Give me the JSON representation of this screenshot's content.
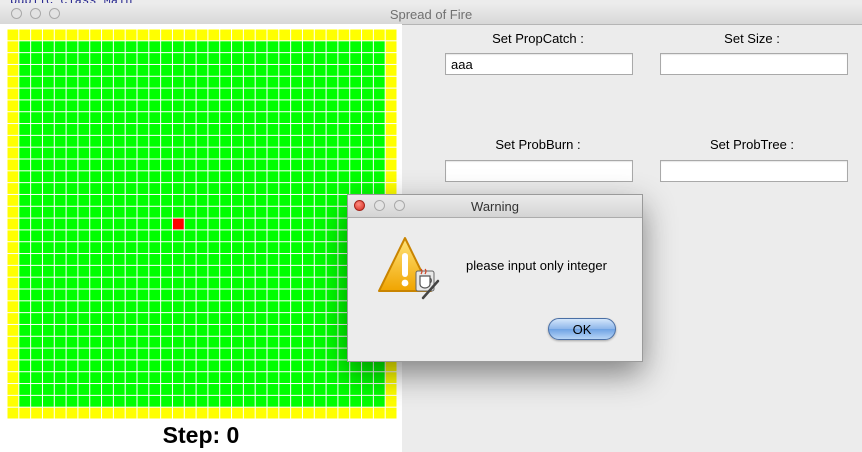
{
  "background_app": {
    "code_text": "public class Main"
  },
  "window": {
    "title": "Spread of Fire"
  },
  "simulation": {
    "grid_size": 33,
    "colors": {
      "border_cell": "#ffff00",
      "tree_cell": "#00ff00",
      "burning_cell": "#ff0000",
      "grid_line": "#ffffff"
    },
    "burning_cell": {
      "row": 16,
      "col": 14
    },
    "step_text": "Step: 0"
  },
  "form": {
    "prop_catch_label": "Set PropCatch :",
    "prop_catch_value": "aaa",
    "size_label": "Set Size :",
    "size_value": "",
    "prob_burn_label": "Set ProbBurn :",
    "prob_burn_value": "",
    "prob_tree_label": "Set ProbTree :",
    "prob_tree_value": ""
  },
  "dialog": {
    "title": "Warning",
    "message": "please input only integer",
    "ok_label": "OK",
    "icon": "warning-triangle-icon"
  }
}
